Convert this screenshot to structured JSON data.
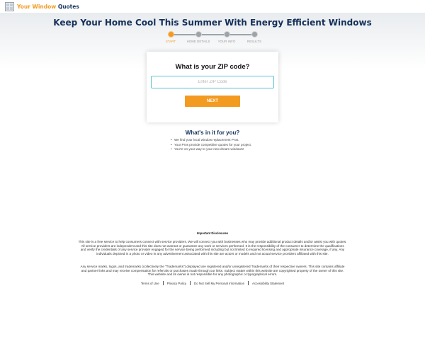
{
  "brand": {
    "word1": "Your Window",
    "word2": "Quotes",
    "color_primary": "#f39a21",
    "color_navy": "#14305a"
  },
  "hero": {
    "title": "Keep Your Home Cool This Summer With Energy Efficient Windows"
  },
  "progress": {
    "current_step": 0,
    "steps": [
      {
        "label": "START"
      },
      {
        "label": "HOME DETAILS"
      },
      {
        "label": "YOUR INFO"
      },
      {
        "label": "RESULTS"
      }
    ]
  },
  "form": {
    "question": "What is your ZIP code?",
    "zip_placeholder": "Enter ZIP Code",
    "zip_value": "",
    "next_label": "NEXT"
  },
  "benefits": {
    "title": "What's in it for you?",
    "items": [
      "We find your local window replacement Pros.",
      "Your Pros provide competitive quotes for your project.",
      "You're on your way to your new dream windows!"
    ]
  },
  "disclosures": {
    "title": "Important Disclosures",
    "paragraph1": "This site is a free service to help consumers connect with service providers. We will connect you with businesses who may provide additional product details and/or assist you with quotes. All service providers are independent and this site does not warrant or guarantee any work or services performed. It is the responsibility of the consumer to determine the qualifications and verify the credentials of any service provider engaged for the service being performed including but not limited to required licensing and appropriate insurance coverage, if any.  Any individuals depicted in a photo or video in any advertisement associated with this site are actors or models and not actual service providers affiliated with this site.",
    "paragraph2": "Any service marks, logos, and trademarks (collectively the \"Trademarks\") displayed are registered and/or unregistered Trademarks of their respective owners. This site contains affiliate and partner links and may receive compensation for referrals or purchases made through our links. Subject matter within this website are copyrighted property of the owner of this site.  This website and its owner is not responsible for any photographic or typographical errors."
  },
  "footer": {
    "links": [
      "Terms of Use",
      "Privacy Policy",
      "Do Not Sell My Personal Information",
      "Accessibility Statement"
    ]
  }
}
